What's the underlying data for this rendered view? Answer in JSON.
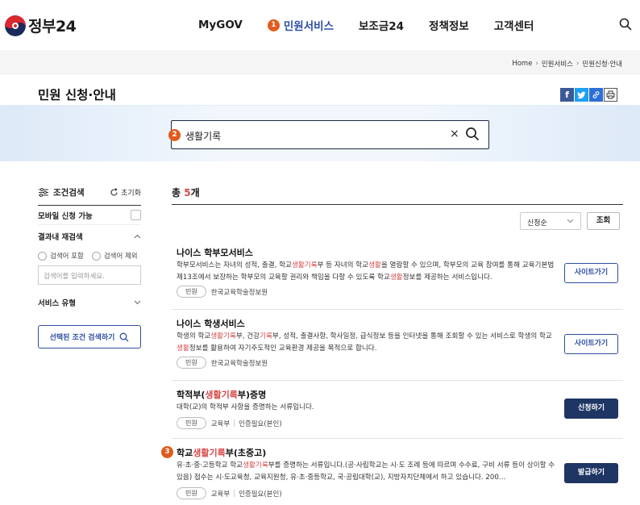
{
  "header": {
    "logo_text": "정부24",
    "nav": [
      {
        "label": "MyGOV"
      },
      {
        "label": "민원서비스",
        "badge": "1"
      },
      {
        "label": "보조금24"
      },
      {
        "label": "정책정보"
      },
      {
        "label": "고객센터"
      }
    ]
  },
  "breadcrumb": [
    "Home",
    "민원서비스",
    "민원신청·안내"
  ],
  "page": {
    "title": "민원 신청·안내"
  },
  "search": {
    "badge": "2",
    "value": "생활기록",
    "clear": "×"
  },
  "filters": {
    "title": "조건검색",
    "reset": "초기화",
    "mobile": "모바일 신청 가능",
    "refine_title": "결과내 재검색",
    "include": "검색어 포함",
    "exclude": "검색어 제외",
    "placeholder": "검색어를 입력하세요.",
    "service_type": "서비스 유형",
    "search_button": "선택된 조건 검색하기"
  },
  "results": {
    "total_prefix": "총 ",
    "total_count": "5",
    "total_suffix": "개",
    "sort_selected": "신청순",
    "query_button": "조회",
    "items": [
      {
        "title": "나이스 학부모서비스",
        "desc": [
          {
            "t": "학부모서비스는 자녀의 성적, 출결, 학교"
          },
          {
            "t": "생활기록",
            "h": true
          },
          {
            "t": "부 등 자녀의 학교"
          },
          {
            "t": "생활",
            "h": true
          },
          {
            "t": "을 열람할 수 있으며, 학부모의 교육 참여를 통해 교육기본법 제13조에서 보장하는 학부모의 교육할 권리와 책임을 다할 수 있도록 학교"
          },
          {
            "t": "생활",
            "h": true
          },
          {
            "t": "정보를 제공하는 서비스입니다."
          }
        ],
        "tag": "민원",
        "org": "한국교육학술정보원",
        "extra": "",
        "button": "사이트가기"
      },
      {
        "title": "나이스 학생서비스",
        "desc": [
          {
            "t": "학생의 학교"
          },
          {
            "t": "생활기록",
            "h": true
          },
          {
            "t": "부, 건강"
          },
          {
            "t": "기록",
            "h": true
          },
          {
            "t": "부, 성적, 출결사항, 학사일정, 급식정보 등을 인터넷을 통해 조회할 수 있는 서비스로 학생의 학교"
          },
          {
            "t": "생활",
            "h": true
          },
          {
            "t": "정보를 활용하여 자기주도적인 교육환경 제공을 목적으로 합니다."
          }
        ],
        "tag": "민원",
        "org": "한국교육학술정보원",
        "extra": "",
        "button": "사이트가기"
      },
      {
        "title_parts": [
          {
            "t": "학적부("
          },
          {
            "t": "생활기록",
            "h": true
          },
          {
            "t": "부)증명"
          }
        ],
        "desc": [
          {
            "t": "대학(교)의 학적부 사항을 증명하는 서류입니다."
          }
        ],
        "tag": "민원",
        "org": "교육부",
        "extra": "인증필요(본인)",
        "button": "신청하기"
      },
      {
        "badge": "3",
        "title_parts": [
          {
            "t": "학교"
          },
          {
            "t": "생활기록",
            "h": true
          },
          {
            "t": "부(초중고)"
          }
        ],
        "desc": [
          {
            "t": "유·초·중·고등학교 학교"
          },
          {
            "t": "생활기록",
            "h": true
          },
          {
            "t": "부를 증명하는 서류입니다.(공·사립학교는 시·도 조례 등에 따르며 수수료, 구비 서류 등이 상이할 수 있음) 접수는 시·도교육청, 교육지원청, 유·초·중등학교, 국·공립대학(교), 지방자치단체에서 하고 있습니다. 200…"
          }
        ],
        "tag": "민원",
        "org": "교육부",
        "extra": "인증필요(본인)",
        "button": "발급하기"
      }
    ]
  },
  "colors": {
    "primary": "#2d4ea3",
    "navy_button": "#1f3564",
    "highlight": "#d94646",
    "badge": "#e25a1c"
  }
}
